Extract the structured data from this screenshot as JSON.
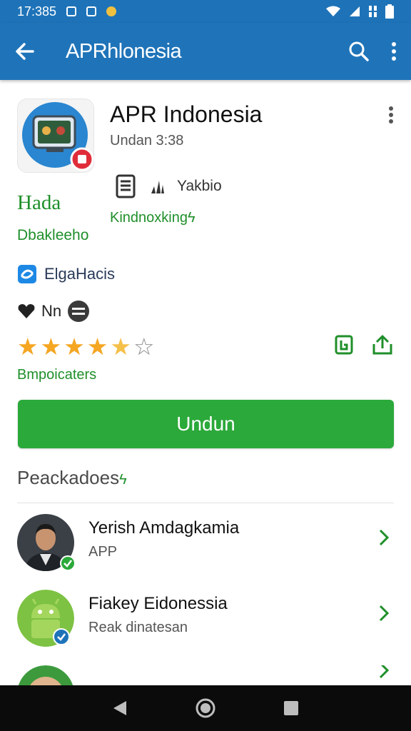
{
  "status_bar": {
    "time": "17:385"
  },
  "app_bar": {
    "title": "APRhlonesia",
    "back_icon": "arrow-left-icon",
    "search_icon": "search-icon",
    "menu_icon": "more-vert-icon"
  },
  "app": {
    "name": "APR Indonesia",
    "subtitle": "Undan 3:38",
    "tag_a": "Hada",
    "tag_b": "Dbakleeho",
    "meta_text": "Yakbio",
    "meta_green": "Kindnoxking",
    "developer": "ElgaHacis",
    "heart_text": "Nn",
    "rating": 4.5,
    "rating_max": 5,
    "rating_label": "Bmpoicaters",
    "accent_color": "#2ba93a",
    "brand_color": "#1f74b9"
  },
  "install_button": {
    "label": "Undun"
  },
  "section": {
    "title": "Peackadoes"
  },
  "list": [
    {
      "title": "Yerish Amdagkamia",
      "subtitle": "APP"
    },
    {
      "title": "Fiakey Eidonessia",
      "subtitle": "Reak dinatesan"
    }
  ]
}
